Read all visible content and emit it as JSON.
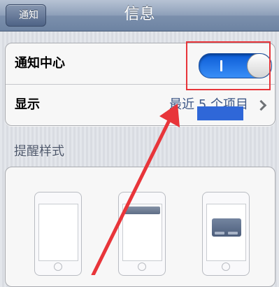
{
  "nav": {
    "back_label": "通知",
    "title": "信息"
  },
  "settings": {
    "notification_center_label": "通知中心",
    "notification_center_on": true,
    "show_label": "显示",
    "show_value": "最近 5 个项目"
  },
  "alert_style": {
    "header": "提醒样式",
    "options": [
      "none-icon",
      "banners-icon",
      "alerts-icon"
    ]
  },
  "colors": {
    "annotation": "#e8353a",
    "toggle_on": "#1f74ec"
  }
}
